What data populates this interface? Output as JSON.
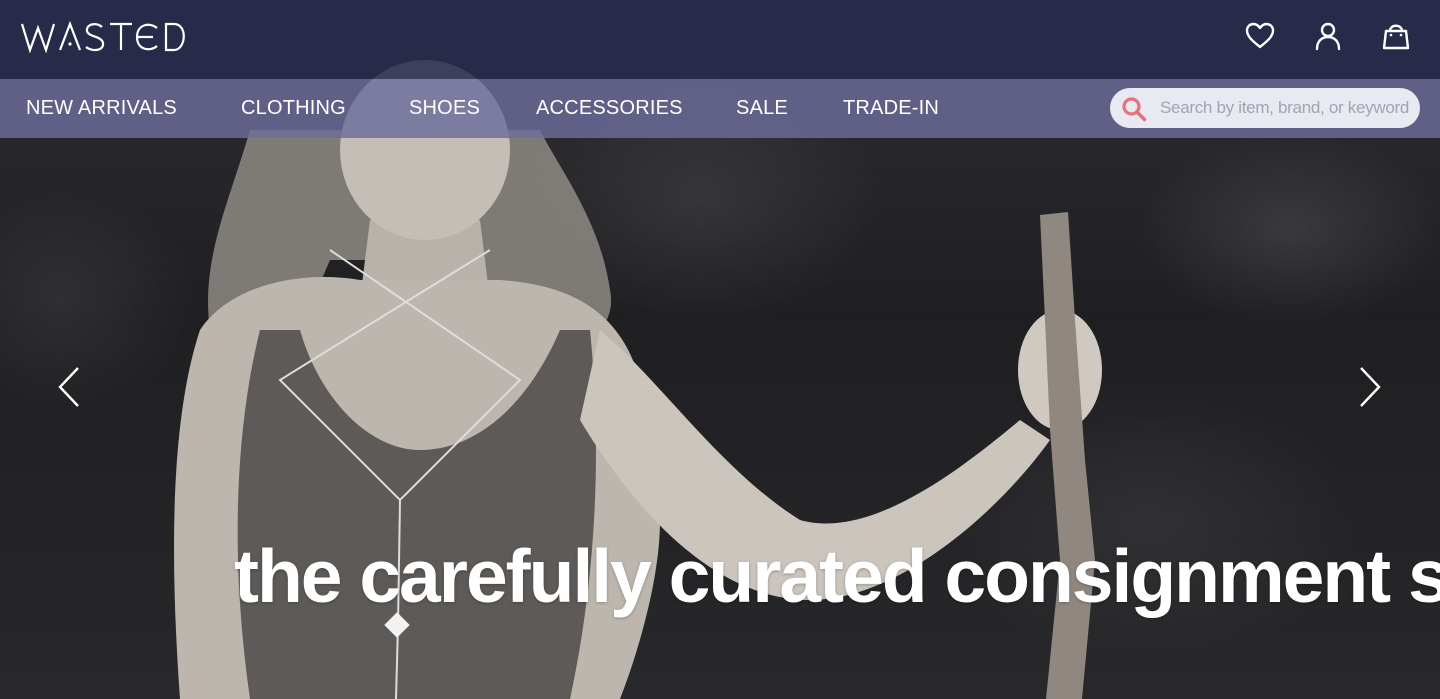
{
  "brand": {
    "logo_text": "WASTED"
  },
  "header": {
    "icons": [
      {
        "name": "heart-icon",
        "label": "Wishlist"
      },
      {
        "name": "user-icon",
        "label": "Account"
      },
      {
        "name": "bag-icon",
        "label": "Shopping bag"
      }
    ]
  },
  "nav": {
    "items": [
      {
        "label": "NEW ARRIVALS"
      },
      {
        "label": "CLOTHING"
      },
      {
        "label": "SHOES"
      },
      {
        "label": "ACCESSORIES"
      },
      {
        "label": "SALE"
      },
      {
        "label": "TRADE-IN"
      }
    ]
  },
  "search": {
    "placeholder": "Search by item, brand, or keyword",
    "value": ""
  },
  "hero": {
    "tagline": "the carefully curated consignment store"
  },
  "colors": {
    "header_bg": "#282a4e",
    "nav_bg": "#6c6c9b",
    "search_bg": "#e9e9f1",
    "search_icon": "#e8707a",
    "text": "#ffffff"
  }
}
